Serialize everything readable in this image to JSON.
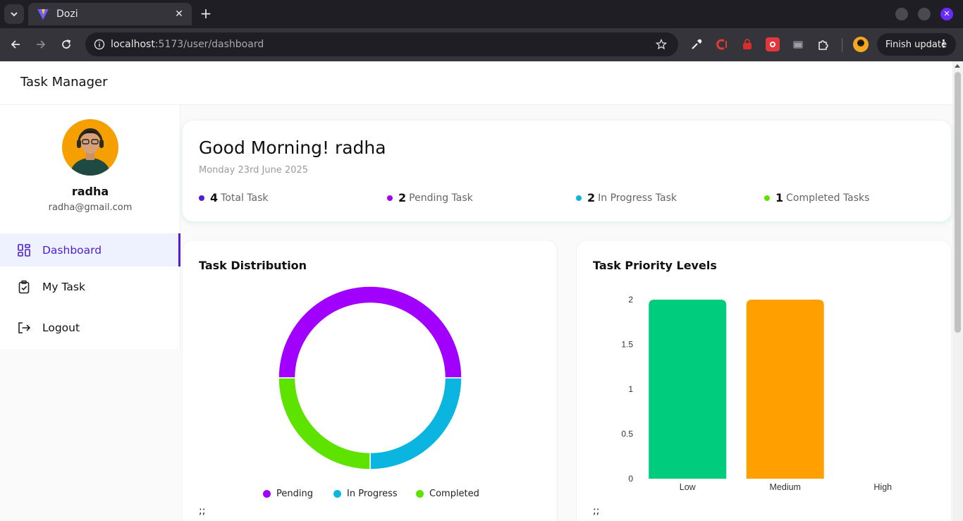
{
  "browser": {
    "tab_title": "Dozi",
    "url_host": "localhost",
    "url_path": ":5173/user/dashboard",
    "finish_update_label": "Finish update"
  },
  "app": {
    "title": "Task Manager"
  },
  "user": {
    "name": "radha",
    "email": "radha@gmail.com"
  },
  "menu": {
    "items": [
      {
        "label": "Dashboard",
        "icon": "dashboard-icon",
        "active": true
      },
      {
        "label": "My Task",
        "icon": "clipboard-check-icon",
        "active": false
      },
      {
        "label": "Logout",
        "icon": "logout-icon",
        "active": false
      }
    ]
  },
  "greeting": {
    "title": "Good Morning! radha",
    "date": "Monday 23rd June 2025",
    "stats": [
      {
        "value": "4",
        "label": "Total Task",
        "color": "#4f1ed4"
      },
      {
        "value": "2",
        "label": "Pending Task",
        "color": "#a100ff"
      },
      {
        "value": "2",
        "label": "In Progress Task",
        "color": "#0ab5e0"
      },
      {
        "value": "1",
        "label": "Completed Tasks",
        "color": "#5ee200"
      }
    ]
  },
  "distribution": {
    "title": "Task Distribution",
    "footer": ";;",
    "legend": [
      {
        "label": "Pending",
        "color": "#a100ff"
      },
      {
        "label": "In Progress",
        "color": "#0ab5e0"
      },
      {
        "label": "Completed",
        "color": "#5ee200"
      }
    ]
  },
  "priority": {
    "title": "Task Priority Levels",
    "footer": ";;"
  },
  "chart_data": [
    {
      "type": "pie",
      "title": "Task Distribution",
      "categories": [
        "Pending",
        "In Progress",
        "Completed"
      ],
      "values": [
        2,
        1,
        1
      ],
      "colors": [
        "#a100ff",
        "#0ab5e0",
        "#5ee200"
      ],
      "donut": true,
      "legend": "bottom"
    },
    {
      "type": "bar",
      "title": "Task Priority Levels",
      "categories": [
        "Low",
        "Medium",
        "High"
      ],
      "values": [
        2,
        2,
        0
      ],
      "colors": [
        "#00cc7e",
        "#ffa000",
        "#ff4d4d"
      ],
      "ylim": [
        0,
        2
      ],
      "yticks": [
        "0",
        "0.5",
        "1",
        "1.5",
        "2"
      ],
      "grid": false
    }
  ]
}
